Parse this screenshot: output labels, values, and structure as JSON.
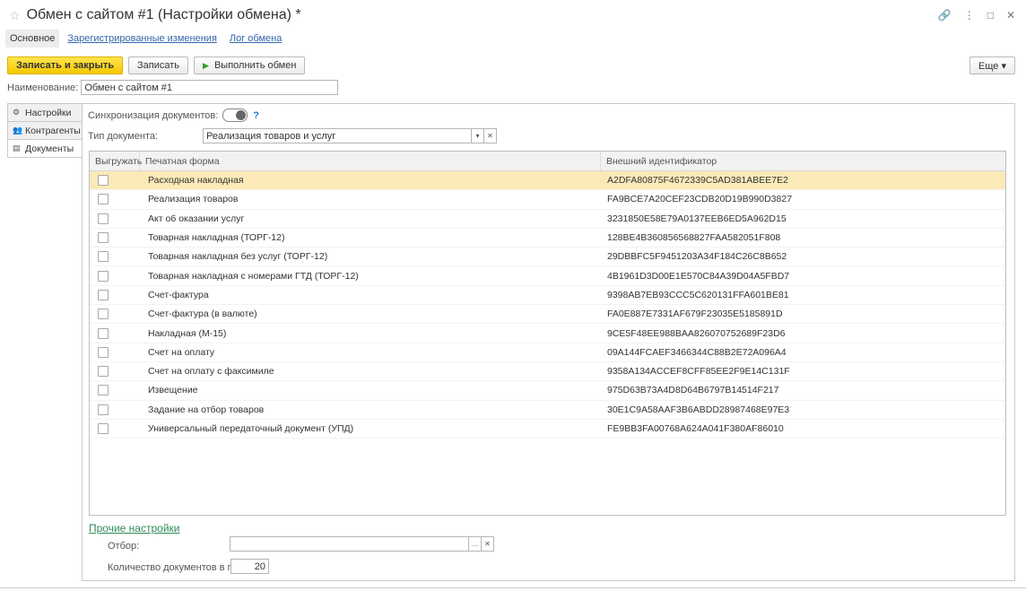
{
  "window": {
    "title": "Обмен с сайтом #1 (Настройки обмена) *",
    "controls": [
      "🔗",
      "⋮",
      "□",
      "✕"
    ]
  },
  "nav_tabs": [
    "Основное",
    "Зарегистрированные изменения",
    "Лог обмена"
  ],
  "toolbar": {
    "save_close": "Записать и закрыть",
    "save": "Записать",
    "run_exchange": "Выполнить обмен",
    "more": "Еще ▾"
  },
  "name_field": {
    "label": "Наименование:",
    "value": "Обмен с сайтом #1"
  },
  "side_tabs": [
    {
      "label": "Настройки",
      "icon": "⚙"
    },
    {
      "label": "Контрагенты",
      "icon": "👥"
    },
    {
      "label": "Документы",
      "icon": "▤"
    }
  ],
  "sync": {
    "label": "Синхронизация документов:",
    "help": "?"
  },
  "doc_type": {
    "label": "Тип документа:",
    "value": "Реализация товаров и услуг"
  },
  "table": {
    "headers": [
      "Выгружать",
      "Печатная форма",
      "Внешний идентификатор"
    ],
    "rows": [
      {
        "form": "Расходная накладная",
        "id": "A2DFA80875F4672339C5AD381ABEE7E2"
      },
      {
        "form": "Реализация товаров",
        "id": "FA9BCE7A20CEF23CDB20D19B990D3827"
      },
      {
        "form": "Акт об оказании услуг",
        "id": "3231850E58E79A0137EEB6ED5A962D15"
      },
      {
        "form": "Товарная накладная (ТОРГ-12)",
        "id": "128BE4B360856568827FAA582051F808"
      },
      {
        "form": "Товарная накладная без услуг (ТОРГ-12)",
        "id": "29DBBFC5F9451203A34F184C26C8B652"
      },
      {
        "form": "Товарная накладная с номерами ГТД (ТОРГ-12)",
        "id": "4B1961D3D00E1E570C84A39D04A5FBD7"
      },
      {
        "form": "Счет-фактура",
        "id": "9398AB7EB93CCC5C620131FFA601BE81"
      },
      {
        "form": "Счет-фактура (в валюте)",
        "id": "FA0E887E7331AF679F23035E5185891D"
      },
      {
        "form": "Накладная (М-15)",
        "id": "9CE5F48EE988BAA826070752689F23D6"
      },
      {
        "form": "Счет на оплату",
        "id": "09A144FCAEF3466344C88B2E72A096A4"
      },
      {
        "form": "Счет на оплату с факсимиле",
        "id": "9358A134ACCEF8CFF85EE2F9E14C131F"
      },
      {
        "form": "Извещение",
        "id": "975D63B73A4D8D64B6797B14514F217"
      },
      {
        "form": "Задание на отбор товаров",
        "id": "30E1C9A58AAF3B6ABDD28987468E97E3"
      },
      {
        "form": "Универсальный передаточный документ (УПД)",
        "id": "FE9BB3FA00768A624A041F380AF86010"
      }
    ]
  },
  "other_settings": {
    "link": "Прочие настройки",
    "filter_label": "Отбор:",
    "filter_value": "",
    "count_label": "Количество документов в пакете:",
    "count_value": "20"
  },
  "colors": {
    "primary_button": "#f5c800",
    "selected_row": "#fbeab8",
    "link_blue": "#3366aa",
    "link_green": "#2e8b57",
    "help_blue": "#1e7ad2"
  }
}
